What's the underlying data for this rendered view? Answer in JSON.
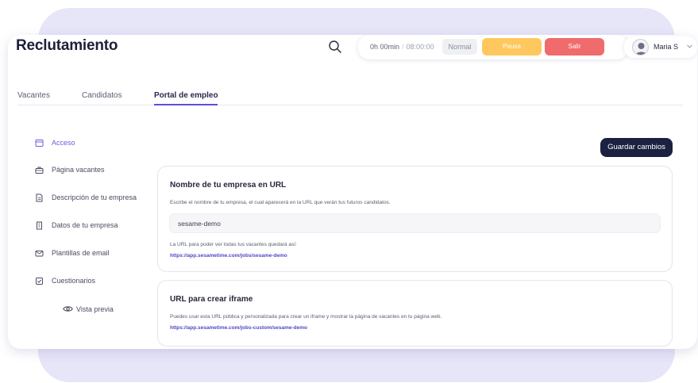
{
  "app": {
    "title": "Reclutamiento"
  },
  "header": {
    "timer": {
      "elapsed": "0h 00min",
      "scheduled": "08:00:00",
      "mode": "Normal"
    },
    "pause_label": "Pausa",
    "exit_label": "Salir",
    "user": {
      "name": "Maria S"
    },
    "colors": {
      "pause": "#ffc85e",
      "exit": "#f06b6b"
    }
  },
  "tabs": [
    {
      "label": "Vacantes",
      "active": false
    },
    {
      "label": "Candidatos",
      "active": false
    },
    {
      "label": "Portal de empleo",
      "active": true
    }
  ],
  "sidebar": {
    "items": [
      {
        "label": "Acceso",
        "icon": "calendar-icon",
        "active": true
      },
      {
        "label": "Página vacantes",
        "icon": "briefcase-icon",
        "active": false
      },
      {
        "label": "Descripción de tu empresa",
        "icon": "document-icon",
        "active": false
      },
      {
        "label": "Datos de tu empresa",
        "icon": "building-icon",
        "active": false
      },
      {
        "label": "Plantillas de email",
        "icon": "mail-icon",
        "active": false
      },
      {
        "label": "Cuestionarios",
        "icon": "checkbox-icon",
        "active": false
      }
    ],
    "preview_label": "Vista previa"
  },
  "main": {
    "save_label": "Guardar cambios",
    "company_card": {
      "title": "Nombre de tu empresa en URL",
      "description": "Escribe el nombre de tu empresa, el cual aparecerá en la URL que verán tus futuros candidatos.",
      "input_value": "sesame-demo",
      "url_note": "La URL para poder ver todas tus vacantes quedará así:",
      "url": "https://app.sesametime.com/jobs/sesame-demo"
    },
    "iframe_card": {
      "title": "URL para crear iframe",
      "description": "Puedes usar esta URL pública y personalizada para crear un iframe y mostrar la página de vacantes en tu página web.",
      "url": "https://app.sesametime.com/jobs-custom/sesame-demo"
    }
  },
  "accent_color": "#5b4fd7"
}
